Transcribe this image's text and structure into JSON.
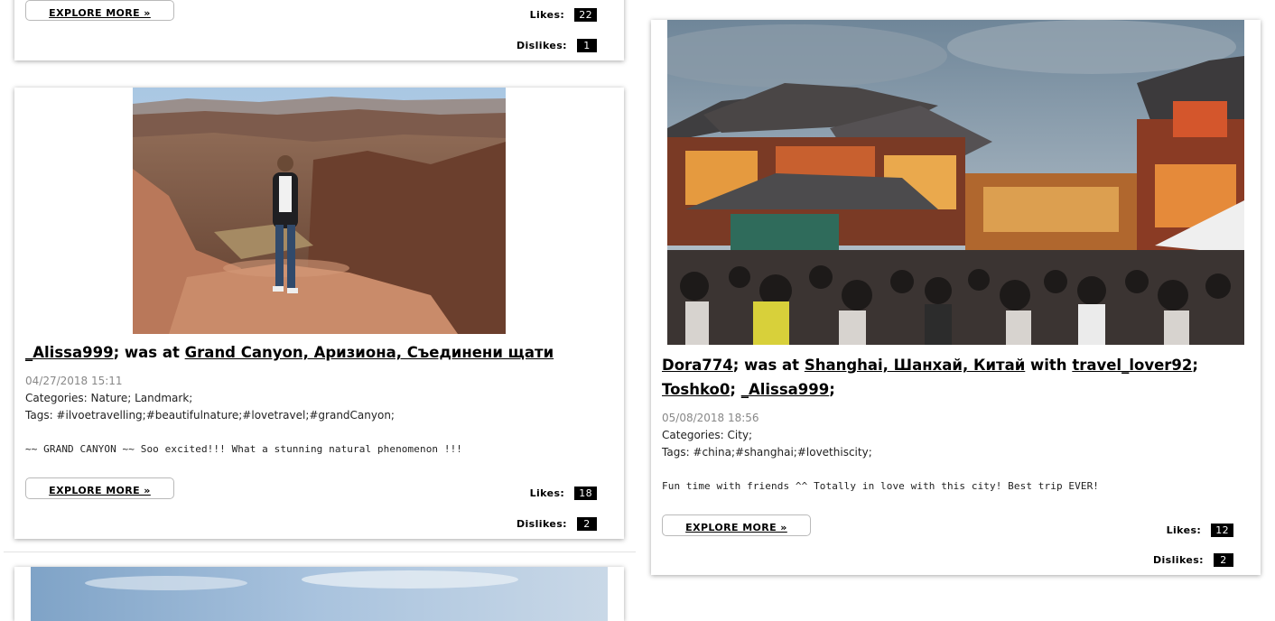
{
  "posts": {
    "top": {
      "explore_label": "EXPLORE MORE »",
      "likes_label": "Likes:",
      "likes": "22",
      "dislikes_label": "Dislikes:",
      "dislikes": "1"
    },
    "grand_canyon": {
      "image_name": "grand-canyon-photo",
      "user": "_Alissa999",
      "was_at": "; was at",
      "location": "Grand Canyon, Аризиона, Съединени щати",
      "date": "04/27/2018 15:11",
      "categories": "Categories: Nature; Landmark;",
      "tags": "Tags: #ilvoetravelling;#beautifulnature;#lovetravel;#grandCanyon;",
      "description": "~~ GRAND CANYON ~~ Soo excited!!! What a stunning natural phenomenon !!!",
      "explore_label": "EXPLORE MORE »",
      "likes_label": "Likes:",
      "likes": "18",
      "dislikes_label": "Dislikes:",
      "dislikes": "2"
    },
    "shanghai": {
      "image_name": "old-town-street-photo",
      "user": "Dora774",
      "was_at": "; was at",
      "location": "Shanghai, Шанхай, Китай",
      "with": "with",
      "friend1": "travel_lover92",
      "friend2": "Toshko0",
      "friend3": "_Alissa999",
      "sep": ";",
      "date": "05/08/2018 18:56",
      "categories": "Categories: City;",
      "tags": "Tags: #china;#shanghai;#lovethiscity;",
      "description": "Fun time with friends ^^ Totally in love with this city! Best trip EVER!",
      "explore_label": "EXPLORE MORE »",
      "likes_label": "Likes:",
      "likes": "12",
      "dislikes_label": "Dislikes:",
      "dislikes": "2"
    },
    "bottom": {
      "image_name": "sky-photo"
    }
  },
  "colors": {
    "badge_bg": "#000000",
    "date_gray": "#888888",
    "card_shadow": "rgba(0,0,0,0.35)"
  }
}
